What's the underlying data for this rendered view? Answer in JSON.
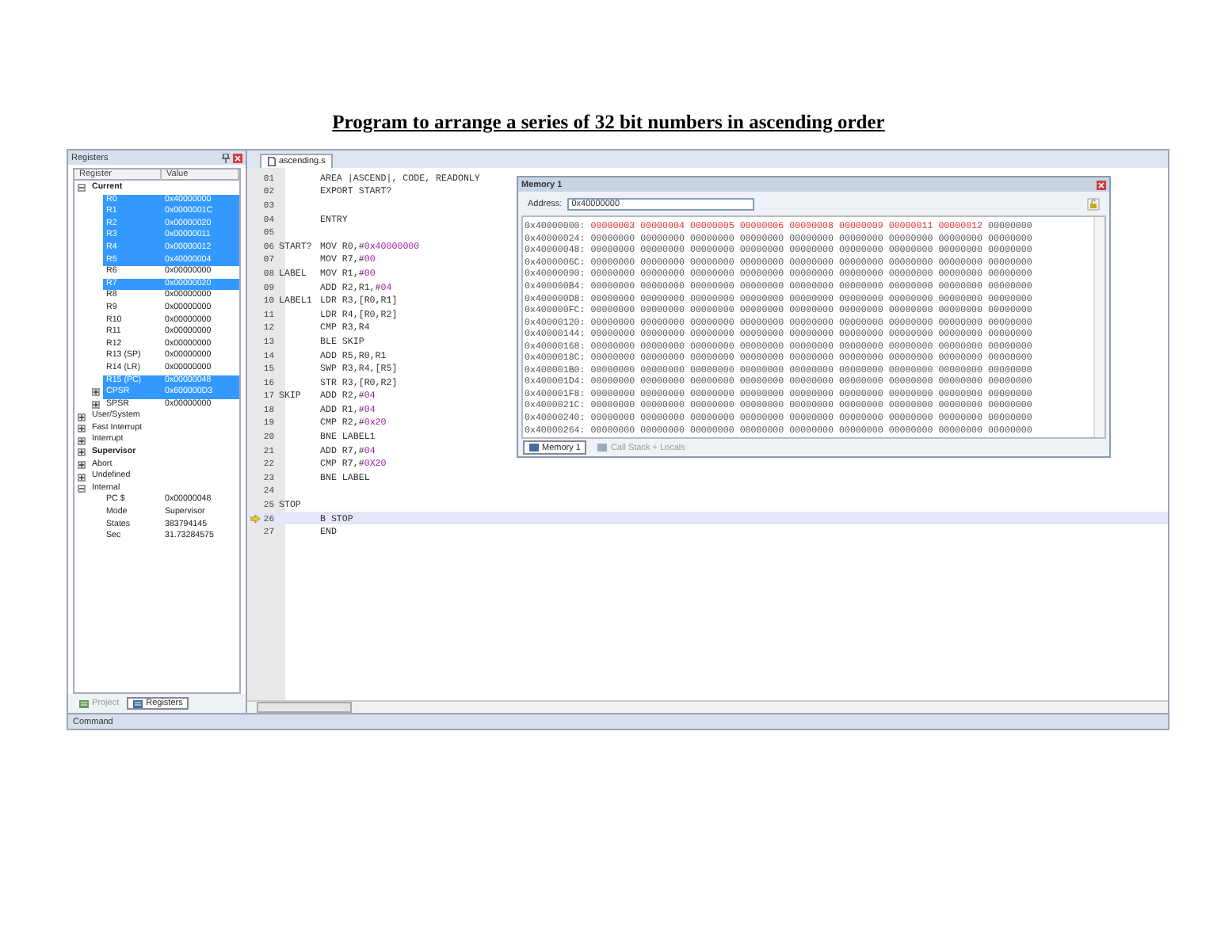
{
  "page_title": "Program to arrange a series of 32 bit numbers in ascending order",
  "registers_panel": {
    "title": "Registers",
    "columns": [
      "Register",
      "Value"
    ],
    "tree": [
      {
        "name": "Current",
        "bold": true,
        "expanded": true,
        "selected": false,
        "children": [
          {
            "name": "R0",
            "value": "0x40000000",
            "selected": true
          },
          {
            "name": "R1",
            "value": "0x0000001C",
            "selected": true
          },
          {
            "name": "R2",
            "value": "0x00000020",
            "selected": true
          },
          {
            "name": "R3",
            "value": "0x00000011",
            "selected": true
          },
          {
            "name": "R4",
            "value": "0x00000012",
            "selected": true
          },
          {
            "name": "R5",
            "value": "0x40000004",
            "selected": true
          },
          {
            "name": "R6",
            "value": "0x00000000",
            "selected": false
          },
          {
            "name": "R7",
            "value": "0x00000020",
            "selected": true
          },
          {
            "name": "R8",
            "value": "0x00000000",
            "selected": false
          },
          {
            "name": "R9",
            "value": "0x00000000",
            "selected": false
          },
          {
            "name": "R10",
            "value": "0x00000000",
            "selected": false
          },
          {
            "name": "R11",
            "value": "0x00000000",
            "selected": false
          },
          {
            "name": "R12",
            "value": "0x00000000",
            "selected": false
          },
          {
            "name": "R13 (SP)",
            "value": "0x00000000",
            "selected": false
          },
          {
            "name": "R14 (LR)",
            "value": "0x00000000",
            "selected": false
          },
          {
            "name": "R15 (PC)",
            "value": "0x00000048",
            "selected": true
          },
          {
            "name": "CPSR",
            "value": "0x600000D3",
            "selected": true,
            "expanded": false
          },
          {
            "name": "SPSR",
            "value": "0x00000000",
            "selected": false,
            "expanded": false
          }
        ]
      },
      {
        "name": "User/System",
        "bold": false,
        "expanded": false,
        "selected": false
      },
      {
        "name": "Fast Interrupt",
        "bold": false,
        "expanded": false,
        "selected": false
      },
      {
        "name": "Interrupt",
        "bold": false,
        "expanded": false,
        "selected": false
      },
      {
        "name": "Supervisor",
        "bold": true,
        "expanded": false,
        "selected": false
      },
      {
        "name": "Abort",
        "bold": false,
        "expanded": false,
        "selected": false
      },
      {
        "name": "Undefined",
        "bold": false,
        "expanded": false,
        "selected": false
      },
      {
        "name": "Internal",
        "bold": false,
        "expanded": true,
        "selected": false,
        "children": [
          {
            "name": "PC $",
            "value": "0x00000048",
            "selected": false
          },
          {
            "name": "Mode",
            "value": "Supervisor",
            "selected": false
          },
          {
            "name": "States",
            "value": "383794145",
            "selected": false
          },
          {
            "name": "Sec",
            "value": "31.73284575",
            "selected": false
          }
        ]
      }
    ],
    "tabs": [
      {
        "label": "Project",
        "selected": false
      },
      {
        "label": "Registers",
        "selected": true
      }
    ]
  },
  "editor": {
    "tab": "ascending.s",
    "lines": [
      {
        "number": "01",
        "code": [
          {
            "kind": "plain",
            "text": "AREA |ASCEND|, CODE, READONLY"
          }
        ],
        "current": false
      },
      {
        "number": "02",
        "code": [
          {
            "kind": "plain",
            "text": "EXPORT START?"
          }
        ],
        "current": false
      },
      {
        "number": "03",
        "current": false
      },
      {
        "number": "04",
        "code": [
          {
            "kind": "plain",
            "text": "ENTRY"
          }
        ],
        "current": false
      },
      {
        "number": "05",
        "current": false
      },
      {
        "number": "06",
        "label": "START?",
        "code": [
          {
            "kind": "plain",
            "text": "MOV R0,#"
          },
          {
            "kind": "number",
            "text": "0x40000000"
          }
        ],
        "current": false
      },
      {
        "number": "07",
        "code": [
          {
            "kind": "plain",
            "text": "MOV R7,#"
          },
          {
            "kind": "number",
            "text": "00"
          }
        ],
        "current": false
      },
      {
        "number": "08",
        "label": "LABEL",
        "code": [
          {
            "kind": "plain",
            "text": "MOV R1,#"
          },
          {
            "kind": "number",
            "text": "00"
          }
        ],
        "current": false
      },
      {
        "number": "09",
        "code": [
          {
            "kind": "plain",
            "text": "ADD R2,R1,#"
          },
          {
            "kind": "number",
            "text": "04"
          }
        ],
        "current": false
      },
      {
        "number": "10",
        "label": "LABEL1",
        "code": [
          {
            "kind": "plain",
            "text": "LDR R3,[R0,R1]"
          }
        ],
        "current": false
      },
      {
        "number": "11",
        "code": [
          {
            "kind": "plain",
            "text": "LDR R4,[R0,R2]"
          }
        ],
        "current": false
      },
      {
        "number": "12",
        "code": [
          {
            "kind": "plain",
            "text": "CMP R3,R4"
          }
        ],
        "current": false
      },
      {
        "number": "13",
        "code": [
          {
            "kind": "plain",
            "text": "BLE SKIP"
          }
        ],
        "current": false
      },
      {
        "number": "14",
        "code": [
          {
            "kind": "plain",
            "text": "ADD R5,R0,R1"
          }
        ],
        "current": false
      },
      {
        "number": "15",
        "code": [
          {
            "kind": "plain",
            "text": "SWP R3,R4,[R5]"
          }
        ],
        "current": false
      },
      {
        "number": "16",
        "code": [
          {
            "kind": "plain",
            "text": "STR R3,[R0,R2]"
          }
        ],
        "current": false
      },
      {
        "number": "17",
        "label": "SKIP",
        "code": [
          {
            "kind": "plain",
            "text": "ADD R2,#"
          },
          {
            "kind": "number",
            "text": "04"
          }
        ],
        "current": false
      },
      {
        "number": "18",
        "code": [
          {
            "kind": "plain",
            "text": "ADD R1,#"
          },
          {
            "kind": "number",
            "text": "04"
          }
        ],
        "current": false
      },
      {
        "number": "19",
        "code": [
          {
            "kind": "plain",
            "text": "CMP R2,#"
          },
          {
            "kind": "number",
            "text": "0x20"
          }
        ],
        "current": false
      },
      {
        "number": "20",
        "code": [
          {
            "kind": "plain",
            "text": "BNE LABEL1"
          }
        ],
        "current": false
      },
      {
        "number": "21",
        "code": [
          {
            "kind": "plain",
            "text": "ADD R7,#"
          },
          {
            "kind": "number",
            "text": "04"
          }
        ],
        "current": false
      },
      {
        "number": "22",
        "code": [
          {
            "kind": "plain",
            "text": "CMP R7,#"
          },
          {
            "kind": "number",
            "text": "0X20"
          }
        ],
        "current": false
      },
      {
        "number": "23",
        "code": [
          {
            "kind": "plain",
            "text": "BNE LABEL"
          }
        ],
        "current": false
      },
      {
        "number": "24",
        "current": false
      },
      {
        "number": "25",
        "label": "STOP",
        "current": false
      },
      {
        "number": "26",
        "code": [
          {
            "kind": "plain",
            "text": "B STOP"
          }
        ],
        "current": true
      },
      {
        "number": "27",
        "code": [
          {
            "kind": "plain",
            "text": "END"
          }
        ],
        "current": false
      }
    ]
  },
  "memory_window": {
    "title": "Memory 1",
    "address_label": "Address:",
    "address": "0x40000000",
    "rows": [
      {
        "address": "0x40000000:",
        "values": [
          "00000003",
          "00000004",
          "00000005",
          "00000006",
          "00000008",
          "00000009",
          "00000011",
          "00000012",
          "00000000"
        ],
        "changed": [
          true,
          true,
          true,
          true,
          true,
          true,
          true,
          true,
          false
        ]
      },
      {
        "address": "0x40000024:",
        "values": [
          "00000000",
          "00000000",
          "00000000",
          "00000000",
          "00000000",
          "00000000",
          "00000000",
          "00000000",
          "00000000"
        ],
        "changed": [
          false,
          false,
          false,
          false,
          false,
          false,
          false,
          false,
          false
        ]
      },
      {
        "address": "0x40000048:",
        "values": [
          "00000000",
          "00000000",
          "00000000",
          "00000000",
          "00000000",
          "00000000",
          "00000000",
          "00000000",
          "00000000"
        ],
        "changed": [
          false,
          false,
          false,
          false,
          false,
          false,
          false,
          false,
          false
        ]
      },
      {
        "address": "0x4000006C:",
        "values": [
          "00000000",
          "00000000",
          "00000000",
          "00000000",
          "00000000",
          "00000000",
          "00000000",
          "00000000",
          "00000000"
        ],
        "changed": [
          false,
          false,
          false,
          false,
          false,
          false,
          false,
          false,
          false
        ]
      },
      {
        "address": "0x40000090:",
        "values": [
          "00000000",
          "00000000",
          "00000000",
          "00000000",
          "00000000",
          "00000000",
          "00000000",
          "00000000",
          "00000000"
        ],
        "changed": [
          false,
          false,
          false,
          false,
          false,
          false,
          false,
          false,
          false
        ]
      },
      {
        "address": "0x400000B4:",
        "values": [
          "00000000",
          "00000000",
          "00000000",
          "00000000",
          "00000000",
          "00000000",
          "00000000",
          "00000000",
          "00000000"
        ],
        "changed": [
          false,
          false,
          false,
          false,
          false,
          false,
          false,
          false,
          false
        ]
      },
      {
        "address": "0x400000D8:",
        "values": [
          "00000000",
          "00000000",
          "00000000",
          "00000000",
          "00000000",
          "00000000",
          "00000000",
          "00000000",
          "00000000"
        ],
        "changed": [
          false,
          false,
          false,
          false,
          false,
          false,
          false,
          false,
          false
        ]
      },
      {
        "address": "0x400000FC:",
        "values": [
          "00000000",
          "00000000",
          "00000000",
          "00000000",
          "00000000",
          "00000000",
          "00000000",
          "00000000",
          "00000000"
        ],
        "changed": [
          false,
          false,
          false,
          false,
          false,
          false,
          false,
          false,
          false
        ]
      },
      {
        "address": "0x40000120:",
        "values": [
          "00000000",
          "00000000",
          "00000000",
          "00000000",
          "00000000",
          "00000000",
          "00000000",
          "00000000",
          "00000000"
        ],
        "changed": [
          false,
          false,
          false,
          false,
          false,
          false,
          false,
          false,
          false
        ]
      },
      {
        "address": "0x40000144:",
        "values": [
          "00000000",
          "00000000",
          "00000000",
          "00000000",
          "00000000",
          "00000000",
          "00000000",
          "00000000",
          "00000000"
        ],
        "changed": [
          false,
          false,
          false,
          false,
          false,
          false,
          false,
          false,
          false
        ]
      },
      {
        "address": "0x40000168:",
        "values": [
          "00000000",
          "00000000",
          "00000000",
          "00000000",
          "00000000",
          "00000000",
          "00000000",
          "00000000",
          "00000000"
        ],
        "changed": [
          false,
          false,
          false,
          false,
          false,
          false,
          false,
          false,
          false
        ]
      },
      {
        "address": "0x4000018C:",
        "values": [
          "00000000",
          "00000000",
          "00000000",
          "00000000",
          "00000000",
          "00000000",
          "00000000",
          "00000000",
          "00000000"
        ],
        "changed": [
          false,
          false,
          false,
          false,
          false,
          false,
          false,
          false,
          false
        ]
      },
      {
        "address": "0x400001B0:",
        "values": [
          "00000000",
          "00000000",
          "00000000",
          "00000000",
          "00000000",
          "00000000",
          "00000000",
          "00000000",
          "00000000"
        ],
        "changed": [
          false,
          false,
          false,
          false,
          false,
          false,
          false,
          false,
          false
        ]
      },
      {
        "address": "0x400001D4:",
        "values": [
          "00000000",
          "00000000",
          "00000000",
          "00000000",
          "00000000",
          "00000000",
          "00000000",
          "00000000",
          "00000000"
        ],
        "changed": [
          false,
          false,
          false,
          false,
          false,
          false,
          false,
          false,
          false
        ]
      },
      {
        "address": "0x400001F8:",
        "values": [
          "00000000",
          "00000000",
          "00000000",
          "00000000",
          "00000000",
          "00000000",
          "00000000",
          "00000000",
          "00000000"
        ],
        "changed": [
          false,
          false,
          false,
          false,
          false,
          false,
          false,
          false,
          false
        ]
      },
      {
        "address": "0x4000021C:",
        "values": [
          "00000000",
          "00000000",
          "00000000",
          "00000000",
          "00000000",
          "00000000",
          "00000000",
          "00000000",
          "00000000"
        ],
        "changed": [
          false,
          false,
          false,
          false,
          false,
          false,
          false,
          false,
          false
        ]
      },
      {
        "address": "0x40000240:",
        "values": [
          "00000000",
          "00000000",
          "00000000",
          "00000000",
          "00000000",
          "00000000",
          "00000000",
          "00000000",
          "00000000"
        ],
        "changed": [
          false,
          false,
          false,
          false,
          false,
          false,
          false,
          false,
          false
        ]
      },
      {
        "address": "0x40000264:",
        "values": [
          "00000000",
          "00000000",
          "00000000",
          "00000000",
          "00000000",
          "00000000",
          "00000000",
          "00000000",
          "00000000"
        ],
        "changed": [
          false,
          false,
          false,
          false,
          false,
          false,
          false,
          false,
          false
        ]
      }
    ],
    "tabs": [
      {
        "label": "Memory 1",
        "selected": true
      },
      {
        "label": "Call Stack + Locals",
        "selected": false
      }
    ]
  },
  "command_bar": {
    "title": "Command"
  }
}
